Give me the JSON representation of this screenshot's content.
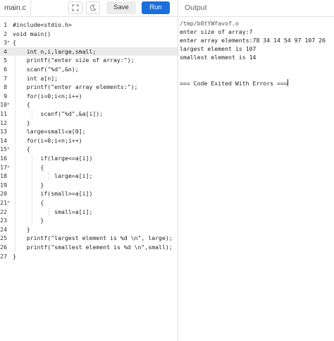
{
  "header": {
    "file_tab": "main.c",
    "save_label": "Save",
    "run_label": "Run",
    "output_title": "Output"
  },
  "icons": {
    "expand": "expand-icon",
    "theme": "moon-icon"
  },
  "colors": {
    "run_button": "#1b6fdc",
    "active_line": "#ebebeb"
  },
  "editor": {
    "active_line": 4,
    "lines": [
      {
        "n": "1",
        "fold": "",
        "text": "#include<stdio.h>"
      },
      {
        "n": "2",
        "fold": "",
        "text": "void main()"
      },
      {
        "n": "3",
        "fold": "▾",
        "text": "{"
      },
      {
        "n": "4",
        "fold": "",
        "text": "    int n,i,large,small;"
      },
      {
        "n": "5",
        "fold": "",
        "text": "    printf(\"enter size of array:\");"
      },
      {
        "n": "6",
        "fold": "",
        "text": "    scanf(\"%d\",&n);"
      },
      {
        "n": "7",
        "fold": "",
        "text": "    int a[n];"
      },
      {
        "n": "8",
        "fold": "",
        "text": "    printf(\"enter array elements:\");"
      },
      {
        "n": "9",
        "fold": "",
        "text": "    for(i=0;i<n;i++)"
      },
      {
        "n": "10",
        "fold": "▾",
        "text": "    {"
      },
      {
        "n": "11",
        "fold": "",
        "text": "        scanf(\"%d\",&a[i]);"
      },
      {
        "n": "12",
        "fold": "",
        "text": "    }"
      },
      {
        "n": "13",
        "fold": "",
        "text": "    large=small=a[0];"
      },
      {
        "n": "14",
        "fold": "",
        "text": "    for(i=0;i<n;i++)"
      },
      {
        "n": "15",
        "fold": "▾",
        "text": "    {"
      },
      {
        "n": "16",
        "fold": "",
        "text": "        if(large<=a[i])"
      },
      {
        "n": "17",
        "fold": "▾",
        "text": "        {"
      },
      {
        "n": "18",
        "fold": "",
        "text": "            large=a[i];"
      },
      {
        "n": "19",
        "fold": "",
        "text": "        }"
      },
      {
        "n": "20",
        "fold": "",
        "text": "        if(small>=a[i])"
      },
      {
        "n": "21",
        "fold": "▾",
        "text": "        {"
      },
      {
        "n": "22",
        "fold": "",
        "text": "            small=a[i];"
      },
      {
        "n": "23",
        "fold": "",
        "text": "        }"
      },
      {
        "n": "24",
        "fold": "",
        "text": "    }"
      },
      {
        "n": "25",
        "fold": "",
        "text": "    printf(\"largest element is %d \\n\", large);"
      },
      {
        "n": "26",
        "fold": "",
        "text": "    printf(\"smallest element is %d \\n\",small);"
      },
      {
        "n": "27",
        "fold": "",
        "text": "}"
      }
    ]
  },
  "output": {
    "path": "/tmp/b8tYWfavof.o",
    "lines": [
      "enter size of array:7",
      "enter array elements:78 34 14 54 97 107 26",
      "largest element is 107",
      "smallest element is 14"
    ],
    "exit_message": "=== Code Exited With Errors ==="
  }
}
